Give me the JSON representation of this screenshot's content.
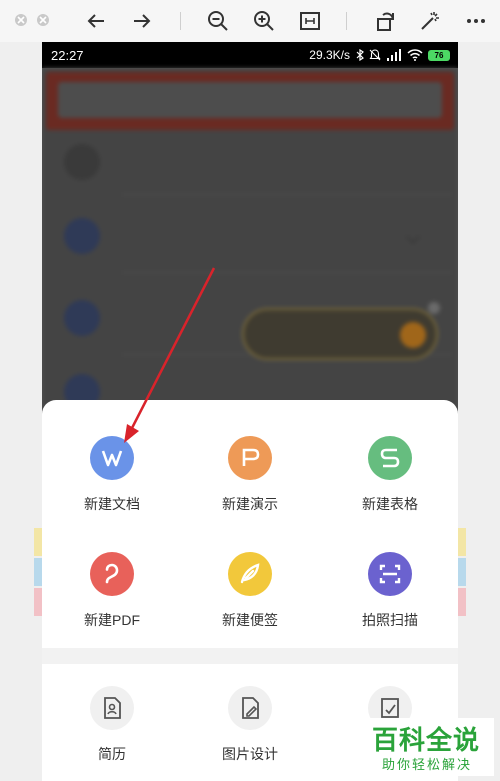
{
  "viewer_toolbar": {
    "icons": [
      "close-dot-icon",
      "minimize-dot-icon",
      "back-arrow-icon",
      "forward-arrow-icon",
      "zoom-out-icon",
      "zoom-in-icon",
      "fit-page-icon",
      "rotate-icon",
      "magic-wand-icon",
      "more-icon"
    ]
  },
  "status_bar": {
    "time": "22:27",
    "net_speed": "29.3K/s",
    "battery": "76",
    "battery_color": "#4cd964"
  },
  "sheet": {
    "create_items": [
      {
        "label": "新建文档",
        "icon": "w-doc-icon",
        "color": "#6a93e8"
      },
      {
        "label": "新建演示",
        "icon": "p-slides-icon",
        "color": "#ee9a57"
      },
      {
        "label": "新建表格",
        "icon": "s-sheet-icon",
        "color": "#66bd7f"
      },
      {
        "label": "新建PDF",
        "icon": "pdf-icon",
        "color": "#e8615a"
      },
      {
        "label": "新建便签",
        "icon": "feather-icon",
        "color": "#f2c83b"
      },
      {
        "label": "拍照扫描",
        "icon": "scan-icon",
        "color": "#6b62cf"
      }
    ],
    "templates": [
      {
        "label": "简历",
        "icon": "resume-icon"
      },
      {
        "label": "图片设计",
        "icon": "image-design-icon"
      },
      {
        "label": "",
        "icon": "edit-doc-icon"
      }
    ]
  },
  "annotation": {
    "arrow_color": "#d9232b"
  },
  "watermark": {
    "title": "百科全说",
    "subtitle": "助你轻松解决",
    "color": "#2aa33a"
  }
}
